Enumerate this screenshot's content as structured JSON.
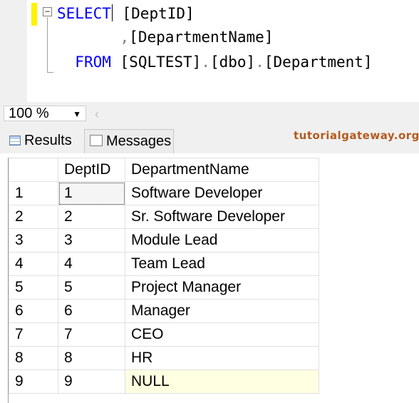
{
  "editor": {
    "collapse_glyph": "−",
    "line1": {
      "keyword": "SELECT",
      "rest": "[DeptID]"
    },
    "line2": {
      "comma": ",",
      "rest": "[DepartmentName]"
    },
    "line3": {
      "keyword": "FROM",
      "db": "[SQLTEST]",
      "dot1": ".",
      "schema": "[dbo]",
      "dot2": ".",
      "table": "[Department]"
    }
  },
  "zoombar": {
    "zoom_value": "100 %",
    "dropdown_arrow_icon": "chevron-down-icon",
    "scroll_left_glyph": "‹"
  },
  "tabs": [
    {
      "label": "Results",
      "icon": "grid-icon",
      "selected": true
    },
    {
      "label": "Messages",
      "icon": "messages-icon",
      "selected": false
    }
  ],
  "watermark": "tutorialgateway.org",
  "grid": {
    "columns": [
      "",
      "DeptID",
      "DepartmentName"
    ],
    "rows": [
      {
        "n": "1",
        "id": "1",
        "name": "Software Developer"
      },
      {
        "n": "2",
        "id": "2",
        "name": "Sr. Software Developer"
      },
      {
        "n": "3",
        "id": "3",
        "name": "Module Lead"
      },
      {
        "n": "4",
        "id": "4",
        "name": "Team Lead"
      },
      {
        "n": "5",
        "id": "5",
        "name": "Project Manager"
      },
      {
        "n": "6",
        "id": "6",
        "name": "Manager"
      },
      {
        "n": "7",
        "id": "7",
        "name": "CEO"
      },
      {
        "n": "8",
        "id": "8",
        "name": "HR"
      },
      {
        "n": "9",
        "id": "9",
        "name": "NULL"
      }
    ]
  },
  "colors": {
    "keyword": "#0000ff",
    "null_bg": "#ffffe1",
    "watermark": "#b45a1e",
    "change_bar": "#fff200"
  }
}
